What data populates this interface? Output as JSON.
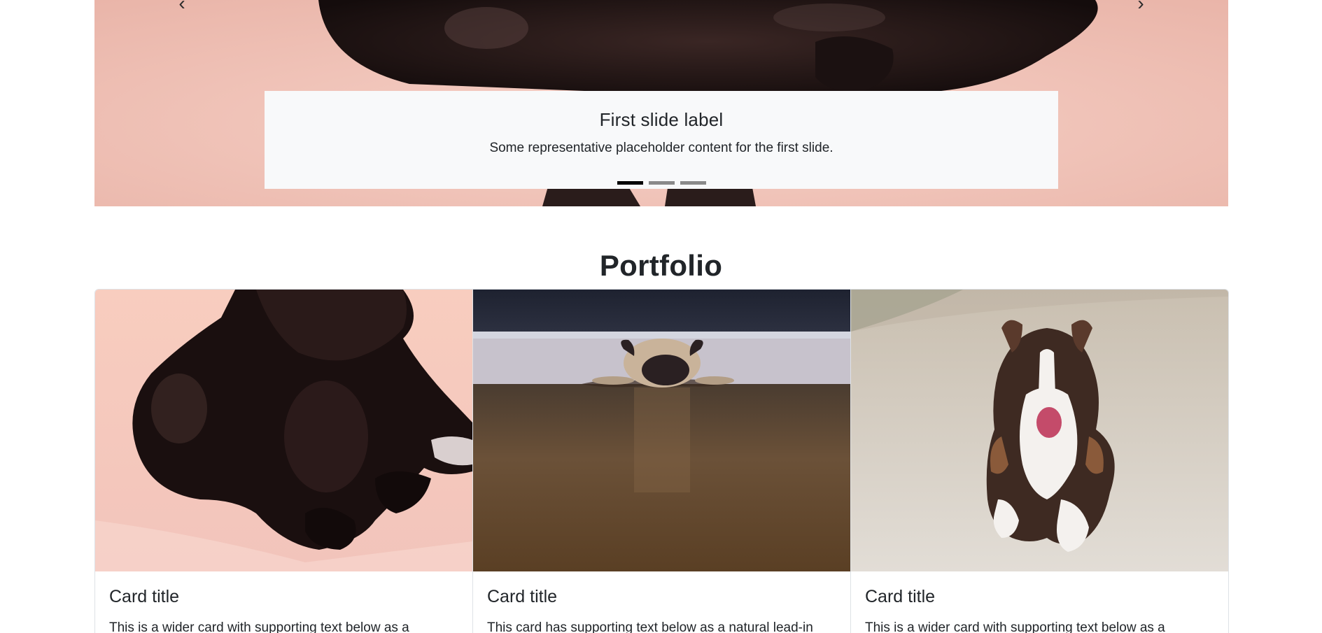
{
  "carousel": {
    "prev_label": "‹",
    "next_label": "›",
    "slide": {
      "title": "First slide label",
      "text": "Some representative placeholder content for the first slide."
    },
    "indicator_count": 3,
    "active_indicator": 1
  },
  "portfolio": {
    "heading": "Portfolio",
    "cards": [
      {
        "image": "black-dog-lying-on-pink-blanket",
        "title": "Card title",
        "text": "This is a wider card with supporting text below as a"
      },
      {
        "image": "pug-lying-on-wooden-floor",
        "title": "Card title",
        "text": "This card has supporting text below as a natural lead-in"
      },
      {
        "image": "australian-shepherd-running-on-sand",
        "title": "Card title",
        "text": "This is a wider card with supporting text below as a"
      }
    ]
  },
  "colors": {
    "caption_bg": "#f8f9fa",
    "text": "#212529",
    "border": "#dee2e6",
    "indicator_active": "#000000",
    "indicator_inactive": "#8a8a8a"
  }
}
